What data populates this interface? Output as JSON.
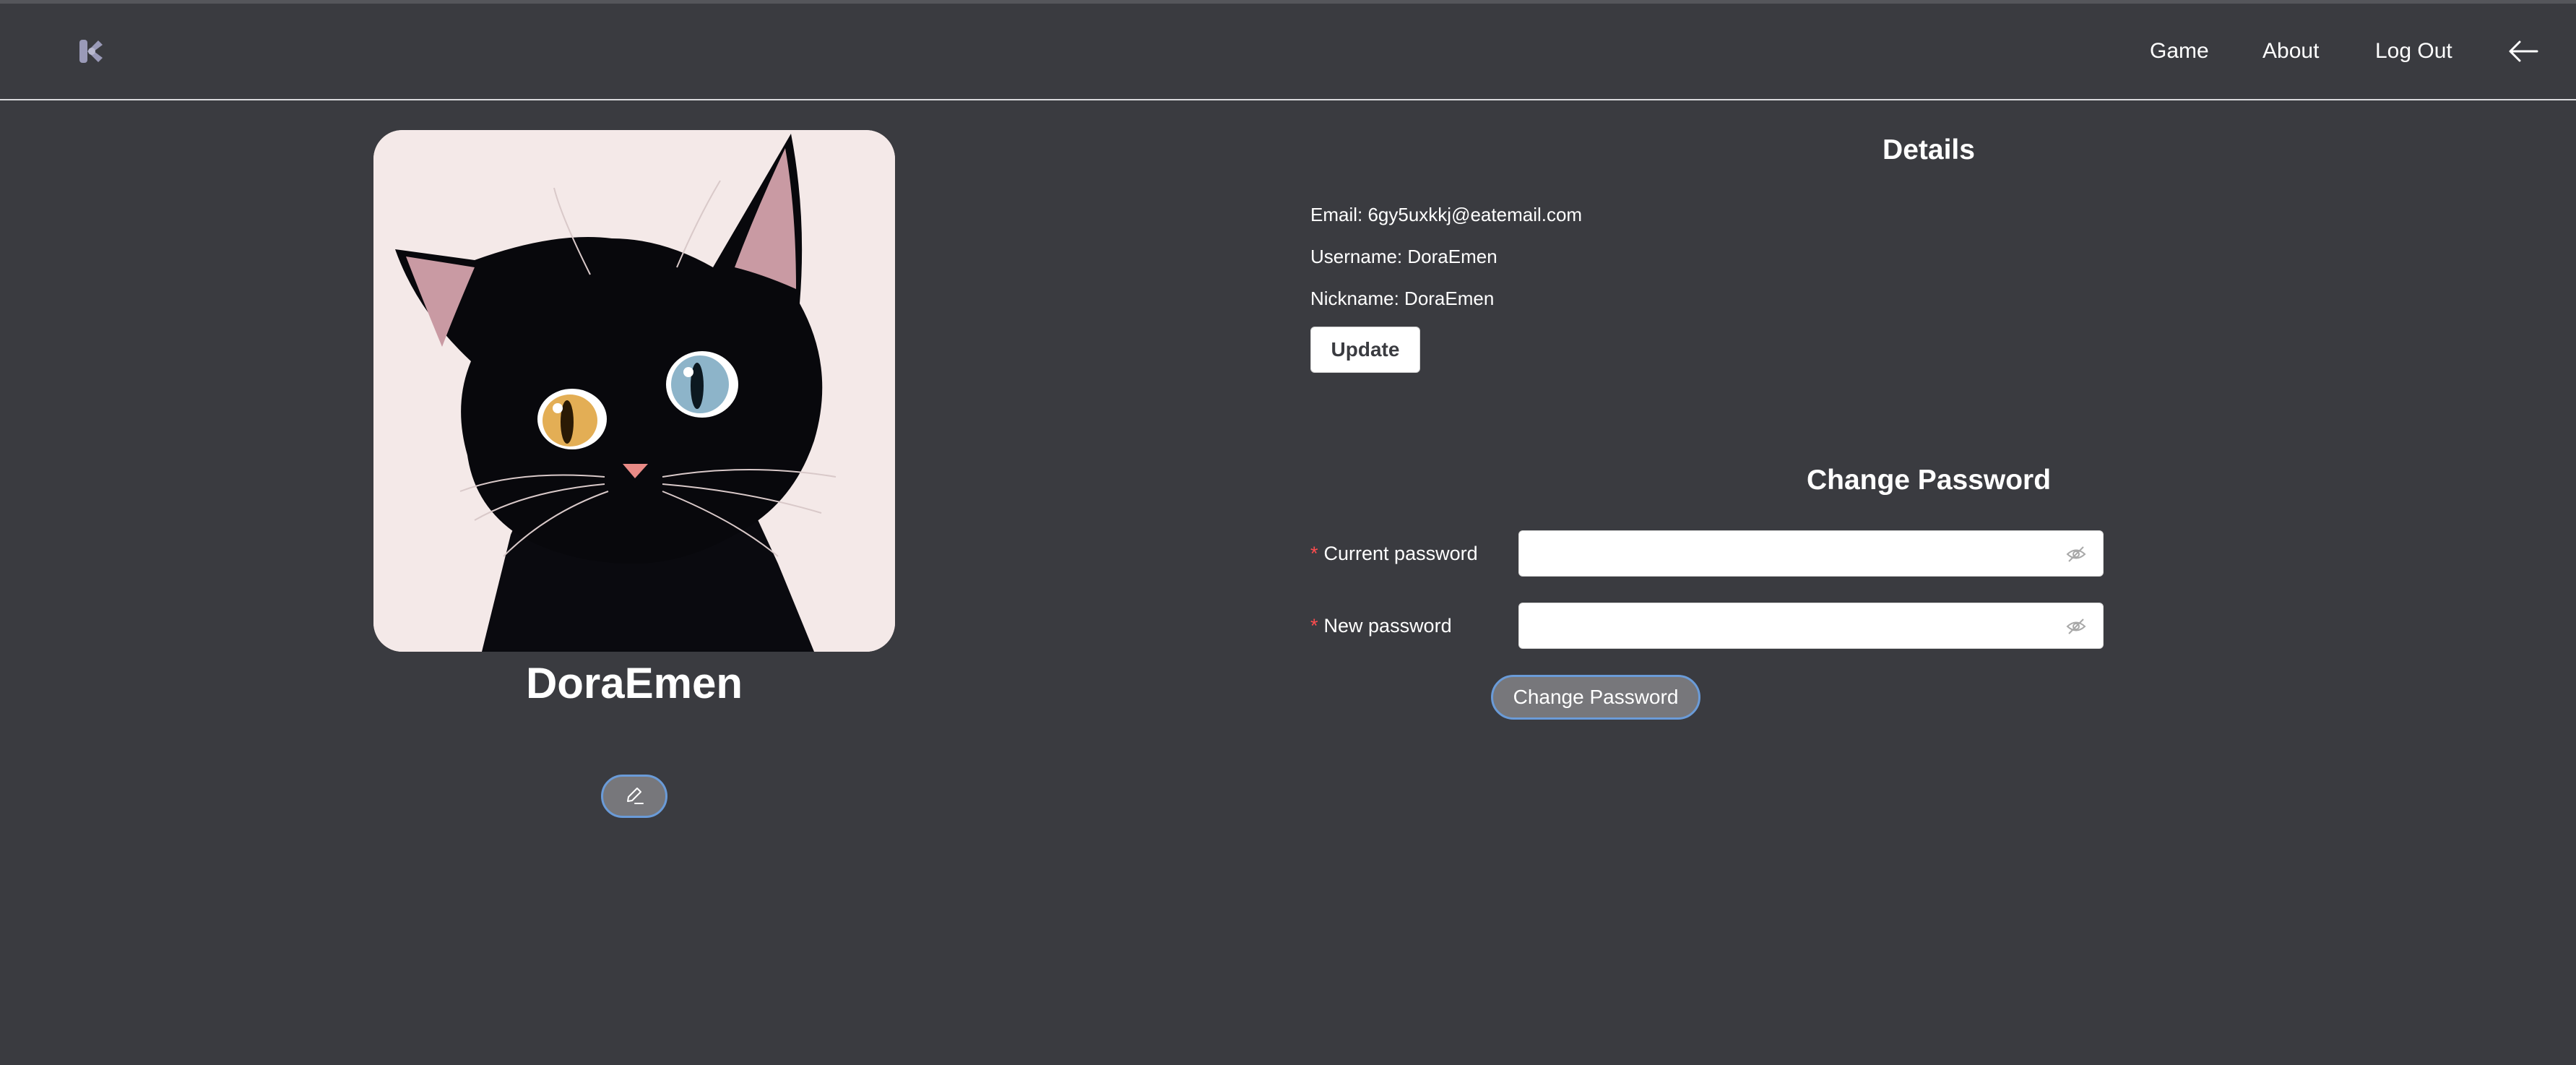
{
  "nav": {
    "logo_icon": "k-logo-icon",
    "links": [
      {
        "label": "Game"
      },
      {
        "label": "About"
      },
      {
        "label": "Log Out"
      }
    ],
    "back_icon": "arrow-left-icon"
  },
  "profile": {
    "display_name": "DoraEmen",
    "avatar_alt": "black cat illustration",
    "edit_icon": "pencil-icon"
  },
  "details": {
    "title": "Details",
    "email": "Email: 6gy5uxkkj@eatemail.com",
    "username": "Username: DoraEmen",
    "nickname": "Nickname: DoraEmen",
    "update_label": "Update"
  },
  "password": {
    "title": "Change Password",
    "required_mark": "*",
    "current_label": "Current password",
    "current_value": "",
    "new_label": "New password",
    "new_value": "",
    "eye_icon": "eye-off-icon",
    "submit_label": "Change Password"
  }
}
